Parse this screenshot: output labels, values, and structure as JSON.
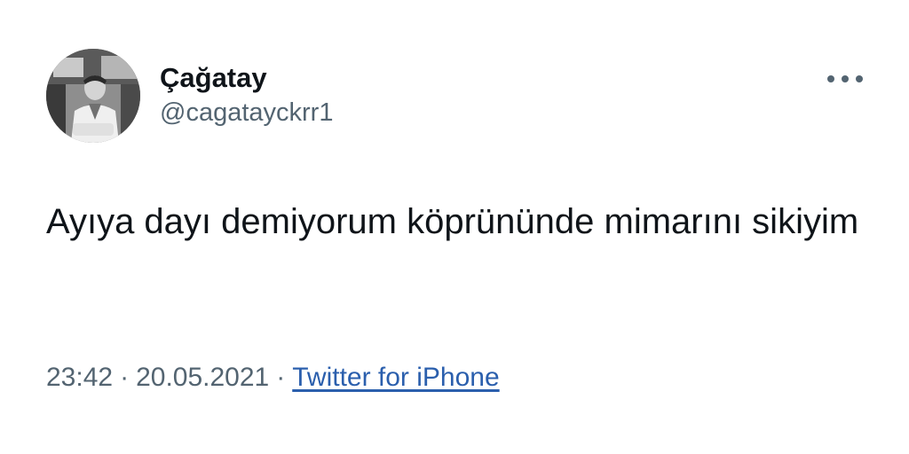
{
  "user": {
    "display_name": "Çağatay",
    "handle": "@cagatayckrr1"
  },
  "tweet": {
    "text": "Ayıya dayı demiyorum köprününde mimarını sikiyim",
    "time": "23:42",
    "date": "20.05.2021",
    "separator": "·",
    "source": "Twitter for iPhone"
  },
  "icons": {
    "more": "more-horizontal-icon",
    "avatar": "profile-photo"
  },
  "colors": {
    "text": "#0f1419",
    "secondary": "#536471",
    "link": "#2b5fad"
  }
}
